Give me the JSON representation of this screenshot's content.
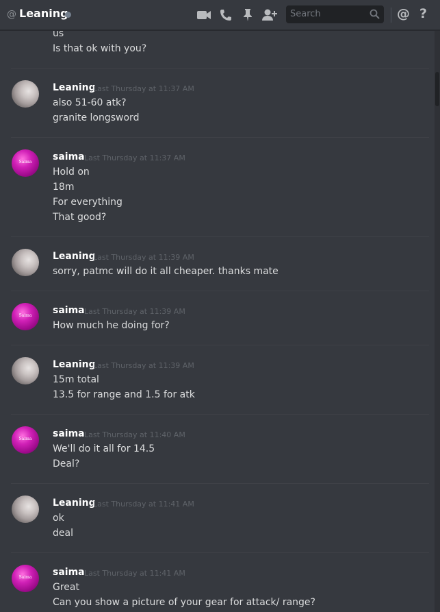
{
  "header": {
    "at_symbol": "@",
    "channel_name": "Leaning",
    "status_color": "#747f8d",
    "search_placeholder": "Search",
    "icons": [
      "video-icon",
      "phone-icon",
      "pin-icon",
      "add-user-icon",
      "search-icon",
      "mention-icon",
      "help-icon"
    ],
    "mention_glyph": "@",
    "help_glyph": "?"
  },
  "messages": {
    "partial": {
      "lines": [
        "us",
        "Is that ok with you?"
      ]
    },
    "groups": [
      {
        "author": "Leaning",
        "avatar": "leaning",
        "timestamp": "Last Thursday at 11:37 AM",
        "lines": [
          "also 51-60 atk?",
          "granite longsword"
        ]
      },
      {
        "author": "saima",
        "avatar": "saima",
        "avatar_text": "Saima",
        "timestamp": "Last Thursday at 11:37 AM",
        "lines": [
          "Hold on",
          "18m",
          "For everything",
          "That good?"
        ]
      },
      {
        "author": "Leaning",
        "avatar": "leaning",
        "timestamp": "Last Thursday at 11:39 AM",
        "lines": [
          "sorry, patmc will do it all cheaper. thanks mate"
        ]
      },
      {
        "author": "saima",
        "avatar": "saima",
        "avatar_text": "Saima",
        "timestamp": "Last Thursday at 11:39 AM",
        "lines": [
          "How much he doing for?"
        ]
      },
      {
        "author": "Leaning",
        "avatar": "leaning",
        "timestamp": "Last Thursday at 11:39 AM",
        "lines": [
          "15m total",
          "13.5 for range and 1.5 for atk"
        ]
      },
      {
        "author": "saima",
        "avatar": "saima",
        "avatar_text": "Saima",
        "timestamp": "Last Thursday at 11:40 AM",
        "lines": [
          "We'll do it all for 14.5",
          "Deal?"
        ]
      },
      {
        "author": "Leaning",
        "avatar": "leaning",
        "timestamp": "Last Thursday at 11:41 AM",
        "lines": [
          "ok",
          "deal"
        ]
      },
      {
        "author": "saima",
        "avatar": "saima",
        "avatar_text": "Saima",
        "timestamp": "Last Thursday at 11:41 AM",
        "lines": [
          "Great",
          "Can you show a picture of your gear for attack/ range?"
        ]
      }
    ]
  },
  "colors": {
    "background": "#36393f",
    "username": "#ffffff",
    "message_text": "#dcddde",
    "timestamp": "#5f6369"
  }
}
